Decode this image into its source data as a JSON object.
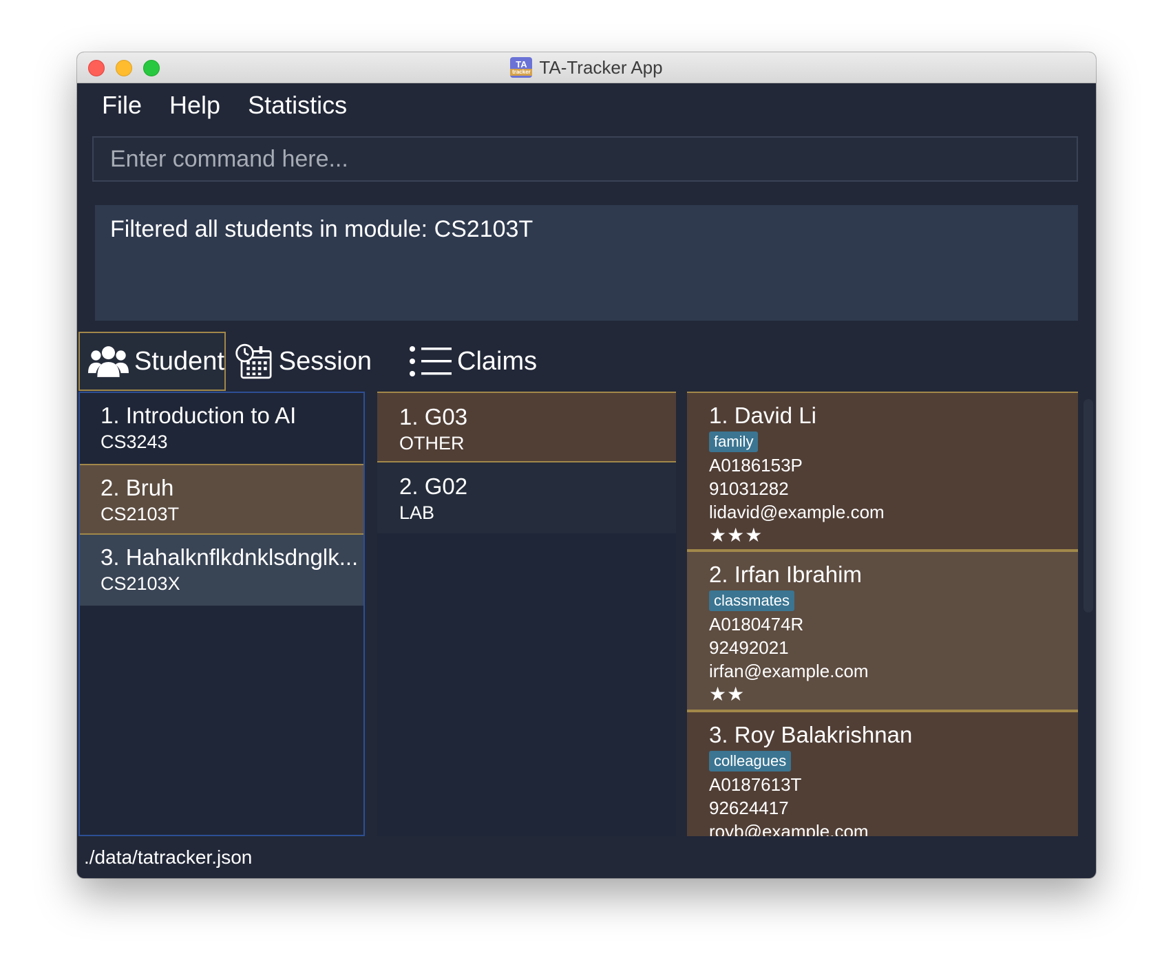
{
  "window": {
    "title": "TA-Tracker App",
    "icon_top": "TA",
    "icon_bottom": "tracker"
  },
  "menu": {
    "items": [
      "File",
      "Help",
      "Statistics"
    ]
  },
  "command": {
    "placeholder": "Enter command here...",
    "value": ""
  },
  "result": {
    "text": "Filtered all students in module: CS2103T"
  },
  "tabs": [
    {
      "label": "Student",
      "icon": "students-icon",
      "active": true
    },
    {
      "label": "Session",
      "icon": "session-clock-calendar-icon",
      "active": false
    },
    {
      "label": "Claims",
      "icon": "list-icon",
      "active": false
    }
  ],
  "modules": [
    {
      "title": "1.  Introduction to AI",
      "code": "CS3243",
      "state": "default"
    },
    {
      "title": "2.  Bruh",
      "code": "CS2103T",
      "state": "selected"
    },
    {
      "title": "3.  Hahalknflkdnklsdnglk...",
      "code": "CS2103X",
      "state": "hover"
    }
  ],
  "groups": [
    {
      "title": "1.  G03",
      "type": "OTHER",
      "state": "selected"
    },
    {
      "title": "2.  G02",
      "type": "LAB",
      "state": "default"
    }
  ],
  "students": [
    {
      "title": "1.  David Li",
      "tag": "family",
      "matric": "A0186153P",
      "phone": "91031282",
      "email": "lidavid@example.com",
      "rating": 3
    },
    {
      "title": "2.  Irfan Ibrahim",
      "tag": "classmates",
      "matric": "A0180474R",
      "phone": "92492021",
      "email": "irfan@example.com",
      "rating": 2
    },
    {
      "title": "3.  Roy Balakrishnan",
      "tag": "colleagues",
      "matric": "A0187613T",
      "phone": "92624417",
      "email": "royb@example.com",
      "rating": 0
    }
  ],
  "status": {
    "path": "./data/tatracker.json"
  },
  "colors": {
    "background": "#222838",
    "selected": "#5d4d41",
    "accent_border": "#a2884a",
    "tag": "#3b7592"
  }
}
